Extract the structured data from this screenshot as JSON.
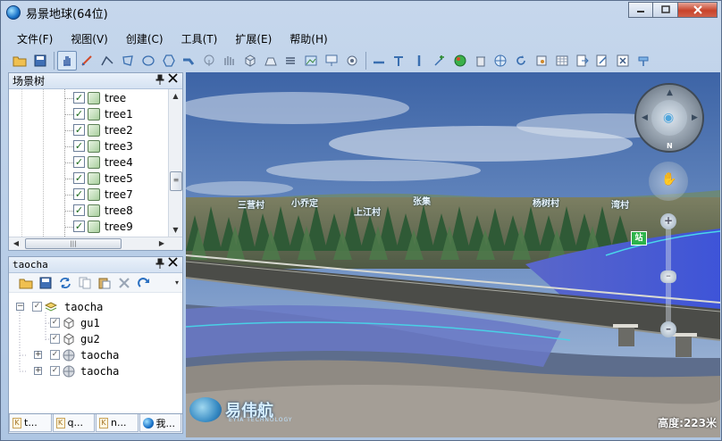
{
  "window": {
    "title": "易景地球(64位)",
    "btn_min": "▭",
    "btn_max": "□",
    "btn_close": "✕"
  },
  "menu": [
    "文件(F)",
    "视图(V)",
    "创建(C)",
    "工具(T)",
    "扩展(E)",
    "帮助(H)"
  ],
  "scene_tree": {
    "title": "场景树",
    "items": [
      "tree",
      "tree1",
      "tree2",
      "tree3",
      "tree4",
      "tree5",
      "tree7",
      "tree8",
      "tree9"
    ]
  },
  "taocha": {
    "title": "taocha",
    "items": [
      {
        "label": "taocha"
      },
      {
        "label": "gu1"
      },
      {
        "label": "gu2"
      },
      {
        "label": "taocha"
      },
      {
        "label": "taocha"
      }
    ]
  },
  "bottom_tabs": [
    "t...",
    "q...",
    "n...",
    "我..."
  ],
  "viewport": {
    "place_labels": [
      "三营村",
      "小乔定",
      "上江村",
      "张集",
      "杨树村",
      "湾村"
    ],
    "brand_name": "易伟航",
    "brand_sub": "EYIA TECHNOLOGY",
    "altitude": "高度:223米",
    "nav_north": "N"
  },
  "colors": {
    "accent": "#1a73c9",
    "river": "#3f5fd8",
    "sky": "#5f86c2"
  }
}
